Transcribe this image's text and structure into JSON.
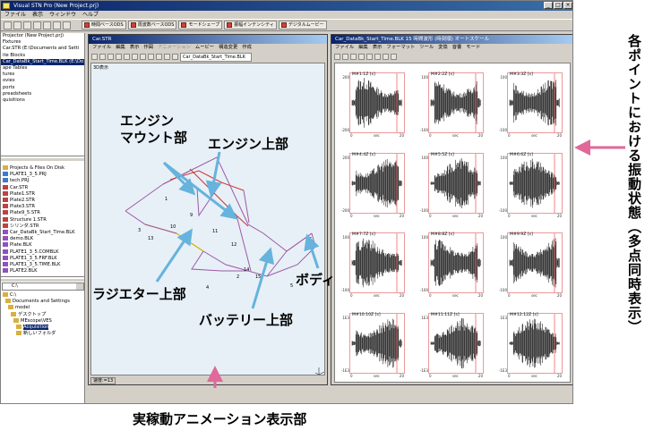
{
  "window": {
    "title": "Visual STN Pro (New Project.prj)"
  },
  "menubar": [
    "ファイル",
    "表示",
    "ウィンドウ",
    "ヘルプ"
  ],
  "toolbar": {
    "btn1": "時間ベースODS",
    "btn2": "周波数ベースODS",
    "btn3": "モードシェープ",
    "btn4": "振幅インテンシティ",
    "btn5": "デジタルムービー"
  },
  "project_tree": {
    "items": [
      "Projector (New Project.prj)",
      "Fixtures",
      "Car.STR (E:\\Documents and Setti",
      "ite Blocks",
      "Car_DataBk_Start_Time.BLK (E:\\Do",
      "ape Tables",
      "tures",
      "ovies",
      "ports",
      "preadsheets",
      "quisitions"
    ]
  },
  "files_tree": {
    "items": [
      "Projects & Files On Disk",
      "PLATE1_3_5.PRJ",
      "tech.PRJ",
      "Car.STR",
      "Plate1.STR",
      "Plate2.STR",
      "Plate3.STR",
      "Plate9_5.STR",
      "Structure 1.STR",
      "シリンダ.STR",
      "Car_DataBk_Start_Time.BLK",
      "demo.BLK",
      "Plate.BLK",
      "PLATE1_3_5.COMBLK",
      "PLATE1_3_5.FRF.BLK",
      "PLATE1_3_5.TIME.BLK",
      "PLATE2.BLK"
    ]
  },
  "drive_combo": "C:\\",
  "folder_tree": {
    "items": [
      "C:\\",
      "Documents and Settings",
      "model",
      "デスクトップ",
      "MEscope\\VES",
      "Acquisition",
      "新しいフォルダ"
    ]
  },
  "anim_window": {
    "title": "Car.STR",
    "menu": [
      "ファイル",
      "編集",
      "表示",
      "作図",
      "アニメーション",
      "ムービー",
      "構造変更",
      "作成"
    ],
    "combo": "Car_DataBk_Start_Time.BLK",
    "viewport_label": "3D表示",
    "status": "速度:=13",
    "node_labels": [
      "1",
      "2",
      "3",
      "4",
      "5",
      "6",
      "9",
      "10",
      "11",
      "12",
      "13",
      "14",
      "15"
    ]
  },
  "plot_window": {
    "title": "Car_DataBk_Start_Time.BLK 15 時間波形 (時刻順) オートスケール",
    "menu": [
      "ファイル",
      "編集",
      "表示",
      "フォーマット",
      "ツール",
      "変換",
      "音響",
      "モード"
    ],
    "plots": [
      {
        "label": "M#1:1Z [s]",
        "ytop": "200",
        "ybot": "-200"
      },
      {
        "label": "M#2:2Z [s]",
        "ytop": "100",
        "ybot": "-100"
      },
      {
        "label": "M#3:3Z [s]",
        "ytop": "100",
        "ybot": "-100"
      },
      {
        "label": "M#4:4Z [s]",
        "ytop": "200",
        "ybot": "-200"
      },
      {
        "label": "M#5:5Z [s]",
        "ytop": "100",
        "ybot": "-100"
      },
      {
        "label": "M#6:6Z [s]",
        "ytop": "100",
        "ybot": "-100"
      },
      {
        "label": "M#7:7Z [s]",
        "ytop": "100",
        "ybot": "-100"
      },
      {
        "label": "M#8:8Z [s]",
        "ytop": "100",
        "ybot": "-100"
      },
      {
        "label": "M#9:9Z [s]",
        "ytop": "100",
        "ybot": "-100"
      },
      {
        "label": "M#10:10Z [s]",
        "ytop": "1E3",
        "ybot": "-1E3"
      },
      {
        "label": "M#11:11Z [s]",
        "ytop": "1E3",
        "ybot": "-1E3"
      },
      {
        "label": "M#12:12Z [s]",
        "ytop": "1E3",
        "ybot": "-1E3"
      }
    ],
    "xlabel": "sec",
    "xticks": [
      "0",
      "20"
    ]
  },
  "callouts": {
    "engine_mount": "エンジン\nマウント部",
    "engine_top": "エンジン上部",
    "radiator_top": "ラジエター上部",
    "battery_top": "バッテリー上部",
    "body": "ボディ",
    "animation_display": "実稼動アニメーション表示部",
    "vibration_state": "各ポイントにおける振動状態（多点同時表示）"
  },
  "colors": {
    "arrow": "#66b3dd",
    "pink_arrow": "#e0689a",
    "signal": "#000000"
  }
}
